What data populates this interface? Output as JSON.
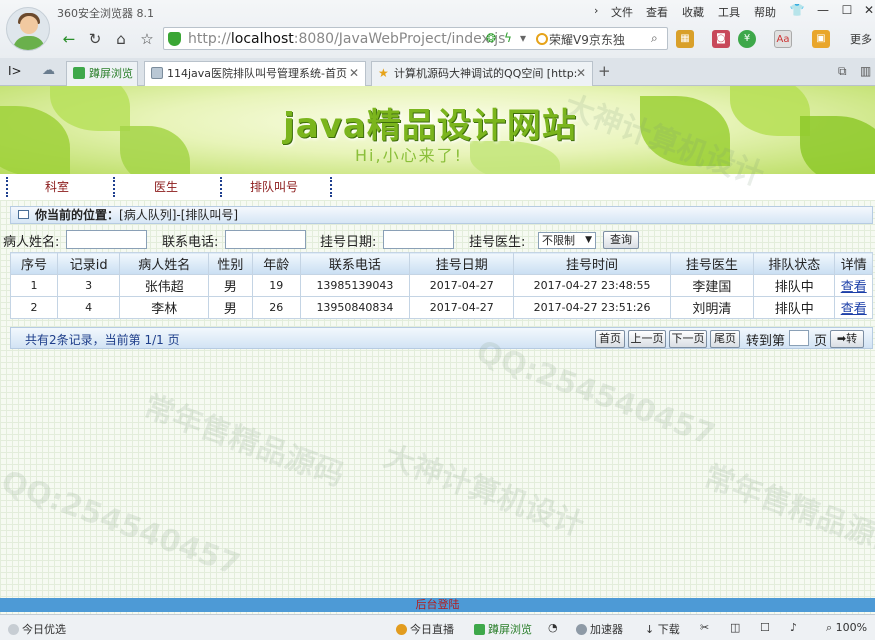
{
  "browser": {
    "app_title": "360安全浏览器 8.1",
    "menu": [
      "文件",
      "查看",
      "收藏",
      "工具",
      "帮助"
    ],
    "address": {
      "url_prefix": "http://",
      "url_host": "localhost",
      "url_rest": ":8080/JavaWebProject/index.js"
    },
    "search_text": "荣耀V9京东独",
    "more_label": "更多",
    "tabs": [
      {
        "label": "蹲屏浏览",
        "icon": "phone-icon"
      },
      {
        "label": "114java医院排队叫号管理系统-首页",
        "icon": "page-icon"
      },
      {
        "label": "计算机源码大神调试的QQ空间 [http:",
        "icon": "star-icon"
      }
    ]
  },
  "site": {
    "title": "java精品设计网站",
    "subtitle": "Hi,小心来了!",
    "nav": [
      "科室",
      "医生",
      "排队叫号"
    ],
    "breadcrumb_label": "你当前的位置：",
    "breadcrumb_path": "[病人队列]-[排队叫号]"
  },
  "filters": {
    "patient_name_label": "病人姓名:",
    "phone_label": "联系电话:",
    "reg_date_label": "挂号日期:",
    "doctor_label": "挂号医生:",
    "doctor_selected": "不限制",
    "query_button": "查询"
  },
  "table": {
    "headers": [
      "序号",
      "记录id",
      "病人姓名",
      "性别",
      "年龄",
      "联系电话",
      "挂号日期",
      "挂号时间",
      "挂号医生",
      "排队状态",
      "详情"
    ],
    "rows": [
      [
        "1",
        "3",
        "张伟超",
        "男",
        "19",
        "13985139043",
        "2017-04-27",
        "2017-04-27 23:48:55",
        "李建国",
        "排队中",
        "查看"
      ],
      [
        "2",
        "4",
        "李林",
        "男",
        "26",
        "13950840834",
        "2017-04-27",
        "2017-04-27 23:51:26",
        "刘明清",
        "排队中",
        "查看"
      ]
    ]
  },
  "pager": {
    "info": "共有2条记录，当前第 1/1 页",
    "first": "首页",
    "prev": "上一页",
    "next": "下一页",
    "last": "尾页",
    "goto_label": "转到第",
    "page_unit": "页",
    "go": "➡转"
  },
  "footer_link": "后台登陆",
  "watermarks": [
    "常年售精品源码",
    "大神计算机设计",
    "QQ:254540457"
  ],
  "statusbar": {
    "left": "今日优选",
    "live": "今日直播",
    "mobile": "蹲屏浏览",
    "accelerate": "加速器",
    "download": "下载",
    "zoom": "100%"
  }
}
